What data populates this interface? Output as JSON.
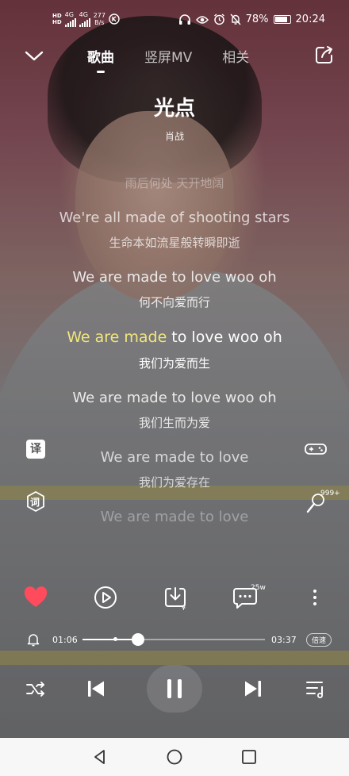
{
  "status_bar": {
    "net_speed": "277",
    "net_unit": "B/s",
    "battery": "78%",
    "time": "20:24",
    "sig1": "4G",
    "sig2": "4G",
    "hd1": "HD",
    "hd2": "HD"
  },
  "tabs": [
    {
      "label": "歌曲",
      "active": true
    },
    {
      "label": "竖屏MV",
      "active": false
    },
    {
      "label": "相关",
      "active": false
    }
  ],
  "song": {
    "title": "光点",
    "artist": "肖战"
  },
  "lyrics": [
    {
      "en": "雨后何处 天开地阔",
      "cn": "",
      "state": "faint"
    },
    {
      "en": "We're all made of shooting stars",
      "cn": "生命本如流星般转瞬即逝",
      "state": "dim"
    },
    {
      "en": "We are made to love woo oh",
      "cn": "何不向爱而行",
      "state": "mid"
    },
    {
      "en_sung": "We are made",
      "en_rest": " to love woo oh",
      "cn": "我们为爱而生",
      "state": "current"
    },
    {
      "en": "We are made to love woo oh",
      "cn": "我们生而为爱",
      "state": "mid"
    },
    {
      "en": "We are made to love",
      "cn": "我们为爱存在",
      "state": "dim"
    },
    {
      "en": "We are made to love",
      "cn": "",
      "state": "faint"
    }
  ],
  "side": {
    "translate_label": "译",
    "lyrics_label": "词",
    "karaoke_count": "999+"
  },
  "actions": {
    "comment_count": "25w"
  },
  "progress": {
    "elapsed": "01:06",
    "total": "03:37",
    "fraction": 0.304,
    "buffer_fraction": 0.18,
    "speed_label": "倍速"
  },
  "colors": {
    "highlight": "#f1e77b",
    "heart": "#ff4b5c"
  }
}
